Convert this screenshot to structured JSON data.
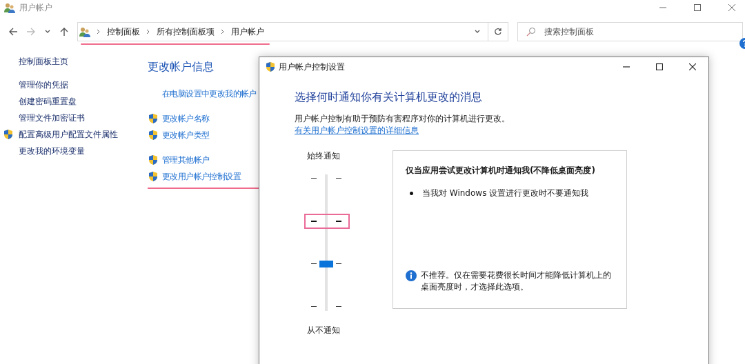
{
  "window": {
    "title": "用户帐户"
  },
  "address_bar": {
    "breadcrumbs": [
      "控制面板",
      "所有控制面板项",
      "用户帐户"
    ],
    "highlighted": true
  },
  "search": {
    "placeholder": "搜索控制面板"
  },
  "sidebar": {
    "items": [
      {
        "label": "控制面板主页",
        "shield": false
      },
      {
        "label": "管理你的凭据",
        "shield": false
      },
      {
        "label": "创建密码重置盘",
        "shield": false
      },
      {
        "label": "管理文件加密证书",
        "shield": false
      },
      {
        "label": "配置高级用户配置文件属性",
        "shield": true
      },
      {
        "label": "更改我的环境变量",
        "shield": false
      }
    ]
  },
  "main": {
    "heading": "更改帐户信息",
    "groups": [
      [
        {
          "label": "在电脑设置中更改我的帐户",
          "shield": false,
          "highlighted": false
        }
      ],
      [
        {
          "label": "更改帐户名称",
          "shield": true,
          "highlighted": false
        },
        {
          "label": "更改帐户类型",
          "shield": true,
          "highlighted": false
        }
      ],
      [
        {
          "label": "管理其他帐户",
          "shield": true,
          "highlighted": false
        },
        {
          "label": "更改用户帐户控制设置",
          "shield": true,
          "highlighted": true
        }
      ]
    ]
  },
  "dialog": {
    "title": "用户帐户控制设置",
    "heading": "选择何时通知你有关计算机更改的消息",
    "description": "用户帐户控制有助于预防有害程序对你的计算机进行更改。",
    "link": "有关用户帐户控制设置的详细信息",
    "slider": {
      "top_label": "始终通知",
      "bottom_label": "从不通知",
      "level": 0.333,
      "ticks": [
        {
          "highlighted": false
        },
        {
          "highlighted": true
        },
        {
          "highlighted": false
        },
        {
          "highlighted": false
        }
      ]
    },
    "info": {
      "title": "仅当应用尝试更改计算机时通知我(不降低桌面亮度)",
      "bullets": [
        "当我对 Windows 设置进行更改时不要通知我"
      ],
      "note": "不推荐。仅在需要花费很长时间才能降低计算机上的桌面亮度时，才选择此选项。"
    }
  }
}
